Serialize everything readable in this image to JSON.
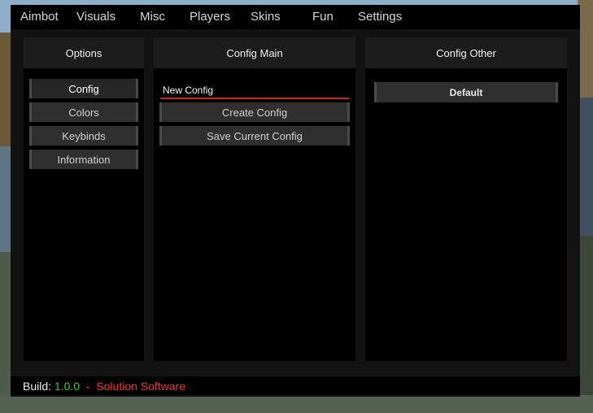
{
  "tabs": [
    "Aimbot",
    "Visuals",
    "Misc",
    "Players",
    "Skins",
    "Fun",
    "Settings"
  ],
  "options_panel": {
    "title": "Options",
    "items": [
      "Config",
      "Colors",
      "Keybinds",
      "Information"
    ],
    "active": "Config"
  },
  "config_main": {
    "title": "Config Main",
    "name_field_value": "New Config",
    "create_label": "Create Config",
    "save_label": "Save Current Config"
  },
  "config_other": {
    "title": "Config Other",
    "configs": [
      "Default"
    ]
  },
  "footer": {
    "build_label": "Build:",
    "version": "1.0.0",
    "separator": "-",
    "brand": "Solution Software"
  },
  "colors": {
    "accent_red": "#c4282a",
    "version_green": "#2fd12f",
    "brand_red": "#ff3030"
  }
}
